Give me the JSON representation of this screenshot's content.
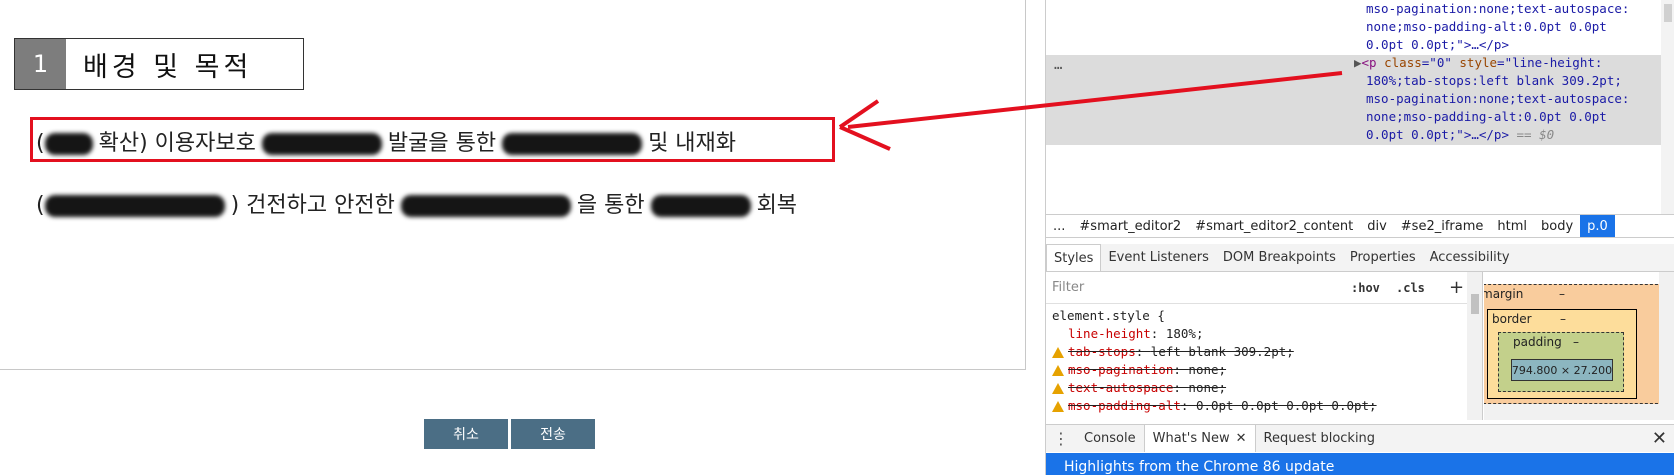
{
  "editor": {
    "heading": {
      "number": "1",
      "title": "배경 및 목적"
    },
    "paragraph1": {
      "w1": "(",
      "w2": "확산) 이용자보호",
      "w3": "발굴을 통한",
      "w4": "및 내재화"
    },
    "paragraph2": {
      "w1": "(",
      "w2": ") 건전하고 안전한",
      "w3": "을 통한",
      "w4": "회복"
    },
    "buttons": {
      "cancel": "취소",
      "send": "전송"
    }
  },
  "devtools": {
    "elements": {
      "line1": "mso-pagination:none;text-autospace:",
      "line2": "none;mso-padding-alt:0.0pt 0.0pt",
      "line3": "0.0pt 0.0pt;\">…</p>",
      "selected": {
        "dots": "…",
        "tag_open": "<p",
        "class_attr": "class",
        "class_val": "\"0\"",
        "style_attr": "style",
        "style_line1": "\"line-height:",
        "style_line2": "180%;tab-stops:left blank 309.2pt;",
        "style_line3": "mso-pagination:none;text-autospace:",
        "style_line4": "none;mso-padding-alt:0.0pt 0.0pt",
        "style_line5": "0.0pt 0.0pt;\">…</p>",
        "eq": "== $0"
      }
    },
    "breadcrumbs": [
      "...",
      "#smart_editor2",
      "#smart_editor2_content",
      "div",
      "#se2_iframe",
      "html",
      "body",
      "p.0"
    ],
    "styles_tabs": [
      "Styles",
      "Event Listeners",
      "DOM Breakpoints",
      "Properties",
      "Accessibility"
    ],
    "filter": {
      "placeholder": "Filter",
      "hov": ":hov",
      "cls": ".cls",
      "plus": "+"
    },
    "rules": {
      "selector": "element.style {",
      "props": [
        {
          "name": "line-height",
          "value": "180%;",
          "struck": false,
          "warn": false
        },
        {
          "name": "tab-stops",
          "value": "left blank 309.2pt;",
          "struck": true,
          "warn": true
        },
        {
          "name": "mso-pagination",
          "value": "none;",
          "struck": true,
          "warn": true
        },
        {
          "name": "text-autospace",
          "value": "none;",
          "struck": true,
          "warn": true
        },
        {
          "name": "mso-padding-alt",
          "value": "0.0pt 0.0pt 0.0pt 0.0pt;",
          "struck": true,
          "warn": true
        }
      ]
    },
    "boxmodel": {
      "margin": "margin",
      "border": "border",
      "padding": "padding",
      "dash": "–",
      "content": "794.800 × 27.200"
    },
    "drawer_tabs": [
      "Console",
      "What's New",
      "Request blocking"
    ],
    "banner": "Highlights from the Chrome 86 update"
  }
}
